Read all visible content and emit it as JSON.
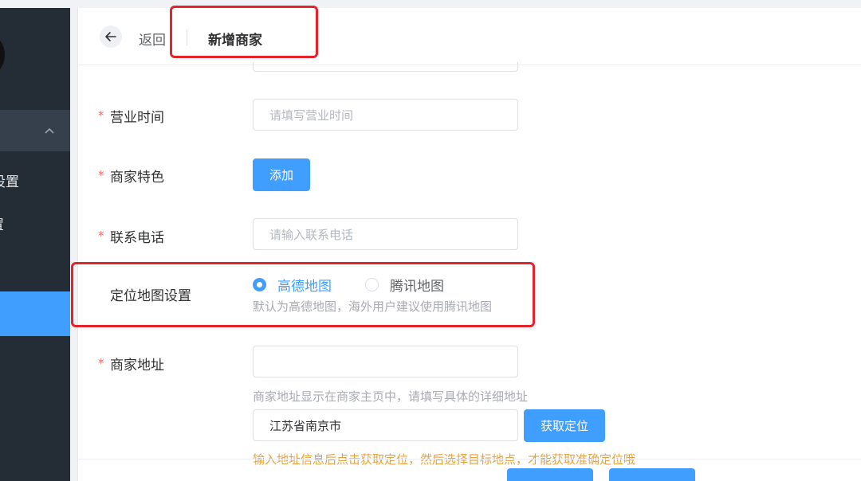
{
  "sidebar": {
    "items": [
      {
        "label": "设置"
      },
      {
        "label": "置"
      }
    ]
  },
  "header": {
    "back_label": "返回",
    "title": "新增商家"
  },
  "form": {
    "business_hours": {
      "label": "营业时间",
      "placeholder": "请填写营业时间"
    },
    "features": {
      "label": "商家特色",
      "button": "添加"
    },
    "phone": {
      "label": "联系电话",
      "placeholder": "请输入联系电话"
    },
    "map_setting": {
      "label": "定位地图设置",
      "options": [
        {
          "label": "高德地图",
          "checked": true
        },
        {
          "label": "腾讯地图",
          "checked": false
        }
      ],
      "hint": "默认为高德地图，海外用户建议使用腾讯地图"
    },
    "address": {
      "label": "商家地址",
      "value": "",
      "hint": "商家地址显示在商家主页中，请填写具体的详细地址",
      "city_value": "江苏省南京市",
      "locate_button": "获取定位",
      "warning": "输入地址信息后点击获取定位，然后选择目标地点，才能获取准确定位哦"
    }
  },
  "colors": {
    "primary": "#409eff",
    "required": "#f56c6c",
    "highlight": "#e3242b",
    "sidebar_bg": "#242c36"
  }
}
